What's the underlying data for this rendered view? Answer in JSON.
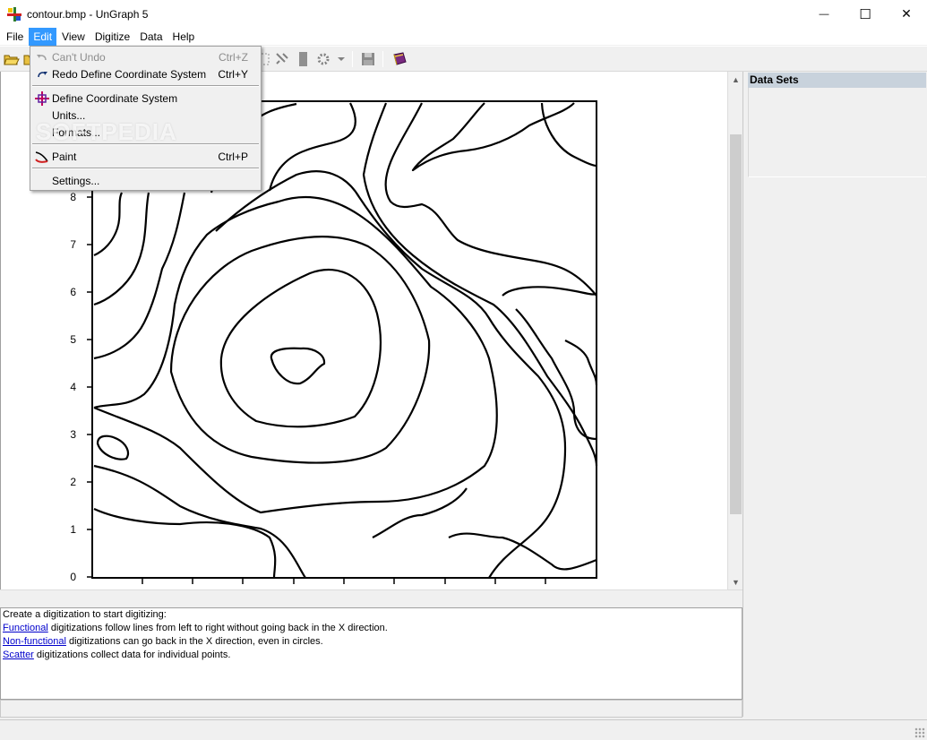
{
  "window": {
    "title": "contour.bmp - UnGraph 5",
    "minimize_glyph": "—",
    "maximize_glyph": "☐",
    "close_glyph": "✕"
  },
  "menubar": {
    "items": [
      "File",
      "Edit",
      "View",
      "Digitize",
      "Data",
      "Help"
    ],
    "active": "Edit"
  },
  "edit_menu": {
    "undo": {
      "label": "Can't Undo",
      "shortcut": "Ctrl+Z",
      "enabled": false
    },
    "redo": {
      "label": "Redo Define Coordinate System",
      "shortcut": "Ctrl+Y"
    },
    "define_cs": {
      "label": "Define Coordinate System"
    },
    "units": {
      "label": "Units..."
    },
    "formats": {
      "label": "Formats..."
    },
    "paint": {
      "label": "Paint",
      "shortcut": "Ctrl+P"
    },
    "settings": {
      "label": "Settings..."
    }
  },
  "watermark": "SOFTPEDIA",
  "toolbar": {
    "icons": [
      "open-folder-icon",
      "save-icon",
      "select-icon",
      "digitize-icon",
      "bar-icon",
      "settings-gear-icon",
      "floppy-icon",
      "book-icon"
    ]
  },
  "plot": {
    "y_ticks": [
      "0",
      "1",
      "2",
      "3",
      "4",
      "5",
      "6",
      "7",
      "8"
    ]
  },
  "data_sets": {
    "header": "Data Sets"
  },
  "info": {
    "line1": "Create a digitization to start digitizing:",
    "functional_link": "Functional",
    "functional_text": " digitizations follow lines from left to right without going back in the X direction.",
    "nonfunctional_link": "Non-functional",
    "nonfunctional_text": " digitizations can go back in the X direction, even in circles.",
    "scatter_link": "Scatter",
    "scatter_text": " digitizations collect data for individual points."
  },
  "colors": {
    "menu_highlight": "#3399ff",
    "link": "#0000cc",
    "data_sets_header": "#c8d2dc"
  }
}
